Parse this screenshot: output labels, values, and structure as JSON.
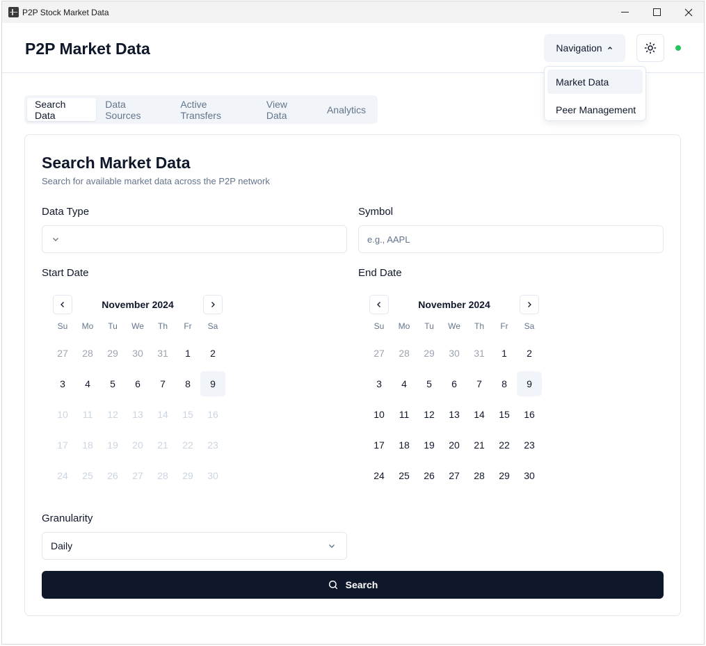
{
  "window": {
    "title": "P2P Stock Market Data"
  },
  "header": {
    "brand": "P2P Market Data",
    "nav_label": "Navigation",
    "status_color": "#22c55e"
  },
  "nav_menu": {
    "items": [
      {
        "label": "Market Data",
        "active": true
      },
      {
        "label": "Peer Management",
        "active": false
      }
    ]
  },
  "tabs": [
    {
      "label": "Search Data",
      "active": true
    },
    {
      "label": "Data Sources",
      "active": false
    },
    {
      "label": "Active Transfers",
      "active": false
    },
    {
      "label": "View Data",
      "active": false
    },
    {
      "label": "Analytics",
      "active": false
    }
  ],
  "card": {
    "title": "Search Market Data",
    "subtitle": "Search for available market data across the P2P network"
  },
  "form": {
    "data_type_label": "Data Type",
    "data_type_value": "",
    "symbol_label": "Symbol",
    "symbol_placeholder": "e.g., AAPL",
    "start_date_label": "Start Date",
    "end_date_label": "End Date",
    "granularity_label": "Granularity",
    "granularity_value": "Daily",
    "search_label": "Search"
  },
  "calendars": {
    "weekdays": [
      "Su",
      "Mo",
      "Tu",
      "We",
      "Th",
      "Fr",
      "Sa"
    ],
    "start": {
      "month_label": "November 2024",
      "weeks": [
        [
          {
            "d": "27",
            "s": "muted"
          },
          {
            "d": "28",
            "s": "muted"
          },
          {
            "d": "29",
            "s": "muted"
          },
          {
            "d": "30",
            "s": "muted"
          },
          {
            "d": "31",
            "s": "muted"
          },
          {
            "d": "1",
            "s": "normal"
          },
          {
            "d": "2",
            "s": "normal"
          }
        ],
        [
          {
            "d": "3",
            "s": "normal"
          },
          {
            "d": "4",
            "s": "normal"
          },
          {
            "d": "5",
            "s": "normal"
          },
          {
            "d": "6",
            "s": "normal"
          },
          {
            "d": "7",
            "s": "normal"
          },
          {
            "d": "8",
            "s": "normal"
          },
          {
            "d": "9",
            "s": "today"
          }
        ],
        [
          {
            "d": "10",
            "s": "disabled"
          },
          {
            "d": "11",
            "s": "disabled"
          },
          {
            "d": "12",
            "s": "disabled"
          },
          {
            "d": "13",
            "s": "disabled"
          },
          {
            "d": "14",
            "s": "disabled"
          },
          {
            "d": "15",
            "s": "disabled"
          },
          {
            "d": "16",
            "s": "disabled"
          }
        ],
        [
          {
            "d": "17",
            "s": "disabled"
          },
          {
            "d": "18",
            "s": "disabled"
          },
          {
            "d": "19",
            "s": "disabled"
          },
          {
            "d": "20",
            "s": "disabled"
          },
          {
            "d": "21",
            "s": "disabled"
          },
          {
            "d": "22",
            "s": "disabled"
          },
          {
            "d": "23",
            "s": "disabled"
          }
        ],
        [
          {
            "d": "24",
            "s": "disabled"
          },
          {
            "d": "25",
            "s": "disabled"
          },
          {
            "d": "26",
            "s": "disabled"
          },
          {
            "d": "27",
            "s": "disabled"
          },
          {
            "d": "28",
            "s": "disabled"
          },
          {
            "d": "29",
            "s": "disabled"
          },
          {
            "d": "30",
            "s": "disabled"
          }
        ]
      ]
    },
    "end": {
      "month_label": "November 2024",
      "weeks": [
        [
          {
            "d": "27",
            "s": "muted"
          },
          {
            "d": "28",
            "s": "muted"
          },
          {
            "d": "29",
            "s": "muted"
          },
          {
            "d": "30",
            "s": "muted"
          },
          {
            "d": "31",
            "s": "muted"
          },
          {
            "d": "1",
            "s": "normal"
          },
          {
            "d": "2",
            "s": "normal"
          }
        ],
        [
          {
            "d": "3",
            "s": "normal"
          },
          {
            "d": "4",
            "s": "normal"
          },
          {
            "d": "5",
            "s": "normal"
          },
          {
            "d": "6",
            "s": "normal"
          },
          {
            "d": "7",
            "s": "normal"
          },
          {
            "d": "8",
            "s": "normal"
          },
          {
            "d": "9",
            "s": "today"
          }
        ],
        [
          {
            "d": "10",
            "s": "normal"
          },
          {
            "d": "11",
            "s": "normal"
          },
          {
            "d": "12",
            "s": "normal"
          },
          {
            "d": "13",
            "s": "normal"
          },
          {
            "d": "14",
            "s": "normal"
          },
          {
            "d": "15",
            "s": "normal"
          },
          {
            "d": "16",
            "s": "normal"
          }
        ],
        [
          {
            "d": "17",
            "s": "normal"
          },
          {
            "d": "18",
            "s": "normal"
          },
          {
            "d": "19",
            "s": "normal"
          },
          {
            "d": "20",
            "s": "normal"
          },
          {
            "d": "21",
            "s": "normal"
          },
          {
            "d": "22",
            "s": "normal"
          },
          {
            "d": "23",
            "s": "normal"
          }
        ],
        [
          {
            "d": "24",
            "s": "normal"
          },
          {
            "d": "25",
            "s": "normal"
          },
          {
            "d": "26",
            "s": "normal"
          },
          {
            "d": "27",
            "s": "normal"
          },
          {
            "d": "28",
            "s": "normal"
          },
          {
            "d": "29",
            "s": "normal"
          },
          {
            "d": "30",
            "s": "normal"
          }
        ]
      ]
    }
  },
  "icons": {
    "app": "chart-app-icon",
    "minimize": "minimize-icon",
    "maximize": "maximize-icon",
    "close": "close-icon",
    "nav_chevron": "chevron-up-icon",
    "theme": "sun-icon",
    "select_chevron": "chevron-down-icon",
    "cal_prev": "chevron-left-icon",
    "cal_next": "chevron-right-icon",
    "search": "search-icon"
  }
}
